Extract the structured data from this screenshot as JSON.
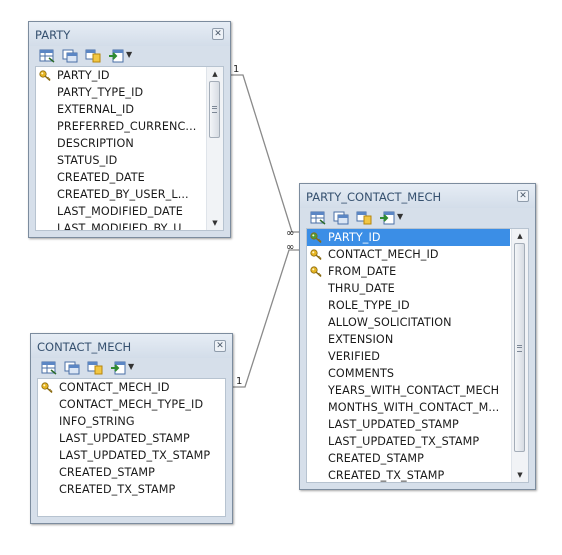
{
  "entities": {
    "party": {
      "title": "PARTY",
      "columns": [
        {
          "name": "PARTY_ID",
          "key": "gold"
        },
        {
          "name": "PARTY_TYPE_ID"
        },
        {
          "name": "EXTERNAL_ID"
        },
        {
          "name": "PREFERRED_CURRENC..."
        },
        {
          "name": "DESCRIPTION"
        },
        {
          "name": "STATUS_ID"
        },
        {
          "name": "CREATED_DATE"
        },
        {
          "name": "CREATED_BY_USER_L..."
        },
        {
          "name": "LAST_MODIFIED_DATE"
        },
        {
          "name": "LAST_MODIFIED_BY_U..."
        }
      ],
      "scroll": {
        "visible_fraction": 0.42,
        "offset_fraction": 0.0
      }
    },
    "contact_mech": {
      "title": "CONTACT_MECH",
      "columns": [
        {
          "name": "CONTACT_MECH_ID",
          "key": "gold"
        },
        {
          "name": "CONTACT_MECH_TYPE_ID"
        },
        {
          "name": "INFO_STRING"
        },
        {
          "name": "LAST_UPDATED_STAMP"
        },
        {
          "name": "LAST_UPDATED_TX_STAMP"
        },
        {
          "name": "CREATED_STAMP"
        },
        {
          "name": "CREATED_TX_STAMP"
        }
      ]
    },
    "party_contact_mech": {
      "title": "PARTY_CONTACT_MECH",
      "selected_column": "PARTY_ID",
      "columns": [
        {
          "name": "PARTY_ID",
          "key": "green"
        },
        {
          "name": "CONTACT_MECH_ID",
          "key": "gold"
        },
        {
          "name": "FROM_DATE",
          "key": "gold"
        },
        {
          "name": "THRU_DATE"
        },
        {
          "name": "ROLE_TYPE_ID"
        },
        {
          "name": "ALLOW_SOLICITATION"
        },
        {
          "name": "EXTENSION"
        },
        {
          "name": "VERIFIED"
        },
        {
          "name": "COMMENTS"
        },
        {
          "name": "YEARS_WITH_CONTACT_MECH"
        },
        {
          "name": "MONTHS_WITH_CONTACT_M..."
        },
        {
          "name": "LAST_UPDATED_STAMP"
        },
        {
          "name": "LAST_UPDATED_TX_STAMP"
        },
        {
          "name": "CREATED_STAMP"
        },
        {
          "name": "CREATED_TX_STAMP"
        }
      ],
      "scroll": {
        "visible_fraction": 0.93,
        "offset_fraction": 0.0
      }
    }
  },
  "relationships": [
    {
      "from": "party",
      "to": "party_contact_mech",
      "from_label": "1",
      "to_label": "∞"
    },
    {
      "from": "contact_mech",
      "to": "party_contact_mech",
      "from_label": "1",
      "to_label": "∞"
    }
  ],
  "icons": [
    "key-icon",
    "table-icon",
    "columns-icon",
    "relation-icon",
    "export-icon",
    "close-icon"
  ],
  "colors": {
    "panel": "#d6dfea",
    "title_text": "#35506f",
    "selection": "#3b8ee6",
    "key_gold": "#e6b422",
    "key_green": "#4f9a3a"
  }
}
